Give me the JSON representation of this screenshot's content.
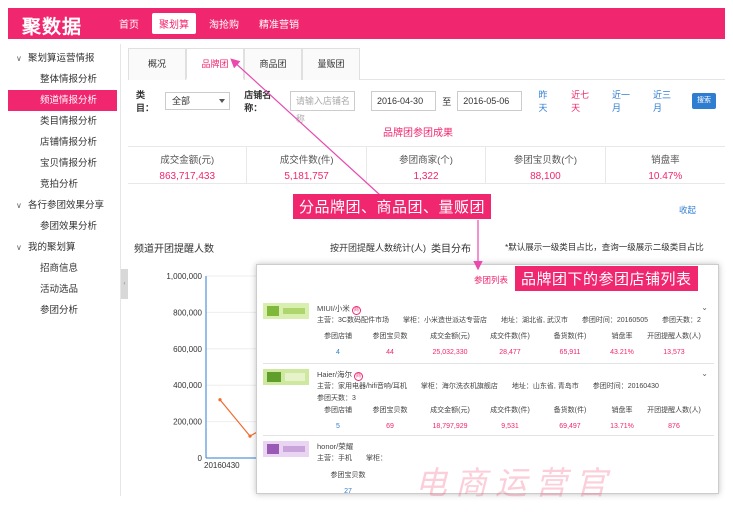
{
  "header": {
    "brand": "聚数据",
    "nav": [
      "首页",
      "聚划算",
      "淘抢购",
      "精准营销"
    ],
    "active_nav": "聚划算"
  },
  "sidebar": {
    "groups": [
      {
        "label": "聚划算运营情报",
        "items": [
          "整体情报分析",
          "频道情报分析",
          "类目情报分析",
          "店铺情报分析",
          "宝贝情报分析",
          "竞拍分析"
        ]
      },
      {
        "label": "各行参团效果分享",
        "items": [
          "参团效果分析"
        ]
      },
      {
        "label": "我的聚划算",
        "items": [
          "招商信息",
          "活动选品",
          "参团分析"
        ]
      }
    ],
    "active_item": "频道情报分析"
  },
  "tabs": [
    "概况",
    "品牌团",
    "商品团",
    "量贩团"
  ],
  "active_tab": "品牌团",
  "filter": {
    "category_label": "类目：",
    "category_value": "全部",
    "store_label": "店铺名称：",
    "store_placeholder": "请输入店铺名称",
    "date_from": "2016-04-30",
    "date_sep": "至",
    "date_to": "2016-05-06",
    "quick": [
      "昨天",
      "近七天",
      "近一月",
      "近三月"
    ],
    "search": "搜索"
  },
  "section_title": "品牌团参团成果",
  "metrics": [
    {
      "label": "成交金额(元)",
      "value": "863,717,433"
    },
    {
      "label": "成交件数(件)",
      "value": "5,181,757"
    },
    {
      "label": "参团商家(个)",
      "value": "1,322"
    },
    {
      "label": "参团宝贝数(个)",
      "value": "88,100"
    },
    {
      "label": "销盘率",
      "value": "10.47%"
    }
  ],
  "collapse": "收起",
  "chart": {
    "title": "频道开团提醒人数",
    "subtitle": "按开团提醒人数统计(人)",
    "category_dist": "类目分布",
    "category_note": "*默认展示一级类目占比，查询一级展示二级类目占比"
  },
  "chart_data": {
    "type": "line",
    "title": "频道开团提醒人数",
    "x": [
      "20160430"
    ],
    "y_ticks": [
      "1,000,000",
      "800,000",
      "600,000",
      "400,000",
      "200,000",
      "0"
    ],
    "ylim": [
      0,
      1000000
    ],
    "series": [
      {
        "values": [
          320000,
          120000,
          210000
        ]
      }
    ]
  },
  "popup": {
    "title": "参团列表",
    "stores": [
      {
        "name": "MIUI/小米",
        "badge": "商",
        "category": "主营：3C数码配件市场",
        "seller": "掌柜：小米造世派达专营店",
        "address": "地址：湖北省, 武汉市",
        "time": "参团时间：20160505",
        "days": "参团天数：2",
        "stat_labels": [
          "参团店铺",
          "参团宝贝数",
          "成交金额(元)",
          "成交件数(件)",
          "备货数(件)",
          "销盘率",
          "开团提醒人数(人)"
        ],
        "stat_values": [
          "4",
          "44",
          "25,032,330",
          "28,477",
          "65,911",
          "43.21%",
          "13,573"
        ]
      },
      {
        "name": "Haier/海尔",
        "badge": "商",
        "category": "主营：家用电器/hifi音响/耳机",
        "seller": "掌柜：海尔洗衣机旗舰店",
        "address": "地址：山东省, 青岛市",
        "time": "参团时间：20160430",
        "days": "参团天数：3",
        "stat_labels": [
          "参团店铺",
          "参团宝贝数",
          "成交金额(元)",
          "成交件数(件)",
          "备货数(件)",
          "销盘率",
          "开团提醒人数(人)"
        ],
        "stat_values": [
          "5",
          "69",
          "18,797,929",
          "9,531",
          "69,497",
          "13.71%",
          "876"
        ]
      },
      {
        "name": "honor/荣耀",
        "category": "主营：手机",
        "seller": "掌柜：",
        "stat_labels": [
          "参团宝贝数"
        ],
        "stat_values": [
          "27"
        ]
      }
    ]
  },
  "callouts": {
    "tabs_note": "分品牌团、商品团、量贩团",
    "list_note": "品牌团下的参团店铺列表"
  },
  "watermark": "电商运营官",
  "colors": {
    "brand": "#f0266e",
    "link": "#2f7dd1"
  }
}
